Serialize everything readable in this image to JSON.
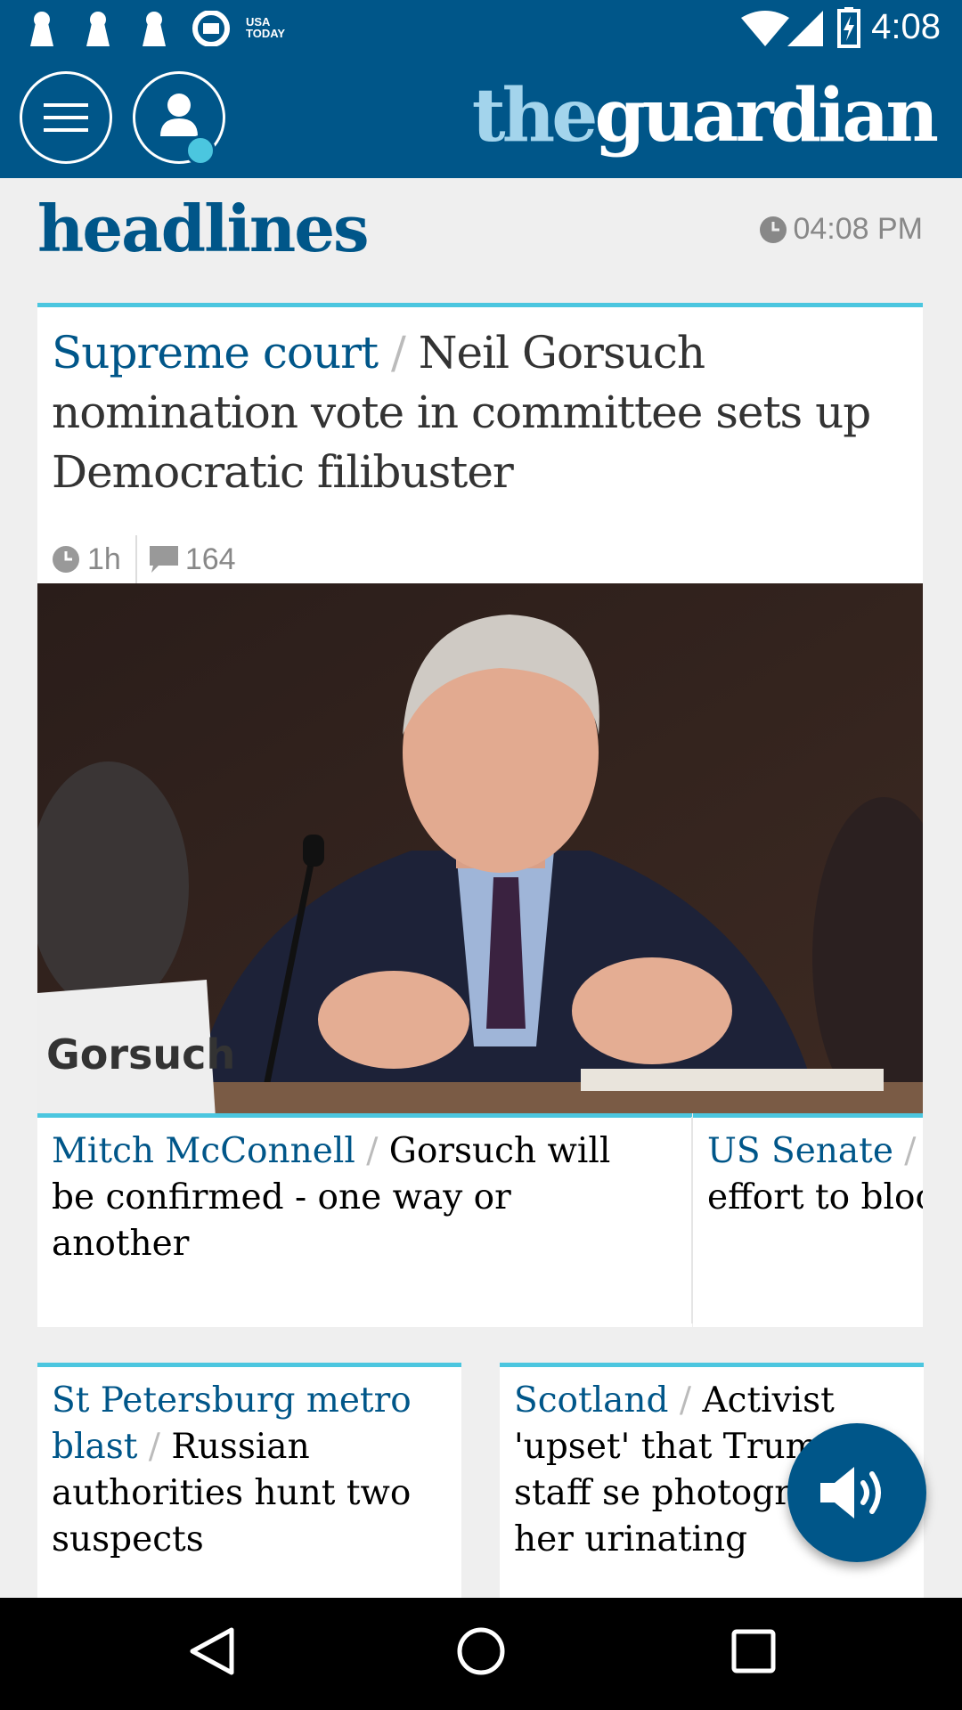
{
  "status_bar": {
    "notification_icons": [
      "keyhole-icon",
      "keyhole-icon",
      "keyhole-icon",
      "guardian-g-icon"
    ],
    "usa_today_line1": "USA",
    "usa_today_line2": "TODAY",
    "time": "4:08"
  },
  "header": {
    "logo_the": "the",
    "logo_guardian": "guardian"
  },
  "section": {
    "title": "headlines",
    "updated_time": "04:08 PM"
  },
  "main_story": {
    "kicker": "Supreme court",
    "separator": " / ",
    "headline": "Neil Gorsuch nomination vote in committee sets up Democratic filibuster",
    "age": "1h",
    "comments": "164",
    "photo_nameplate": "Gorsuch"
  },
  "sub_stories": [
    {
      "kicker": "Mitch McConnell",
      "separator": " / ",
      "headline": "Gorsuch will be confirmed - one way or another"
    },
    {
      "kicker": "US Senate",
      "separator": " / ",
      "headline": "Ta effort to block"
    }
  ],
  "small_stories": [
    {
      "kicker": "St Petersburg metro blast",
      "separator": " / ",
      "headline": "Russian authorities hunt two suspects"
    },
    {
      "kicker": "Scotland",
      "separator": " / ",
      "headline": "Activist 'upset' that Trump staff se photographed her urinating"
    }
  ],
  "colors": {
    "brand_blue": "#005689",
    "accent_cyan": "#4bc6df",
    "logo_light_blue": "#a3d4ec"
  },
  "fab_icon": "speaker-icon",
  "nav_icons": [
    "back-icon",
    "home-icon",
    "recents-icon"
  ]
}
